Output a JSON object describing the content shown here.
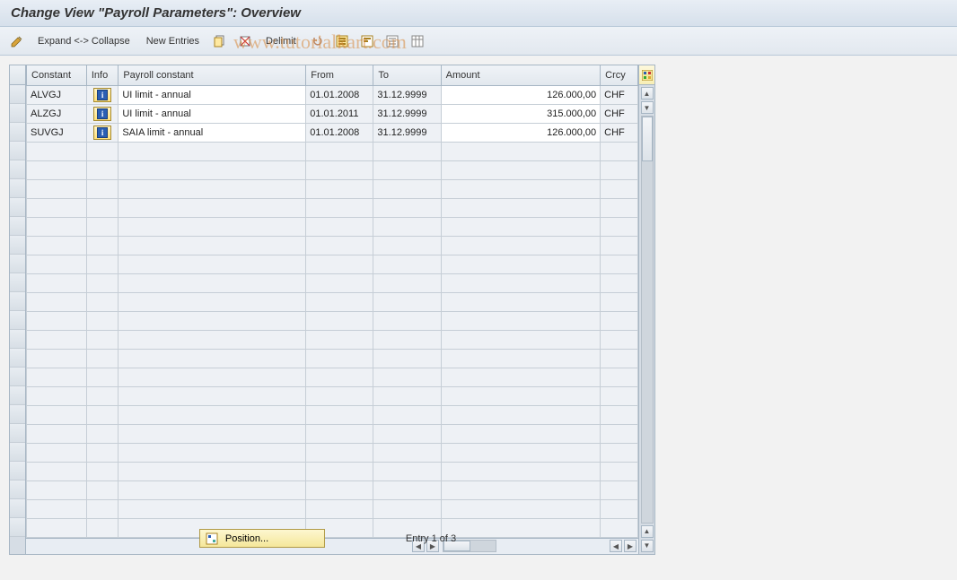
{
  "title": "Change View \"Payroll Parameters\": Overview",
  "toolbar": {
    "expand_collapse": "Expand <-> Collapse",
    "new_entries": "New Entries",
    "delimit": "Delimit"
  },
  "columns": {
    "constant": "Constant",
    "info": "Info",
    "payroll_constant": "Payroll constant",
    "from": "From",
    "to": "To",
    "amount": "Amount",
    "crcy": "Crcy"
  },
  "rows": [
    {
      "constant": "ALVGJ",
      "payroll_constant": "UI limit - annual",
      "from": "01.01.2008",
      "to": "31.12.9999",
      "amount": "126.000,00",
      "crcy": "CHF"
    },
    {
      "constant": "ALZGJ",
      "payroll_constant": "UI limit - annual",
      "from": "01.01.2011",
      "to": "31.12.9999",
      "amount": "315.000,00",
      "crcy": "CHF"
    },
    {
      "constant": "SUVGJ",
      "payroll_constant": "SAIA limit - annual",
      "from": "01.01.2008",
      "to": "31.12.9999",
      "amount": "126.000,00",
      "crcy": "CHF"
    }
  ],
  "empty_row_count": 21,
  "footer": {
    "position_label": "Position...",
    "entry_status": "Entry 1 of 3"
  },
  "icons": {
    "info_glyph": "i"
  }
}
